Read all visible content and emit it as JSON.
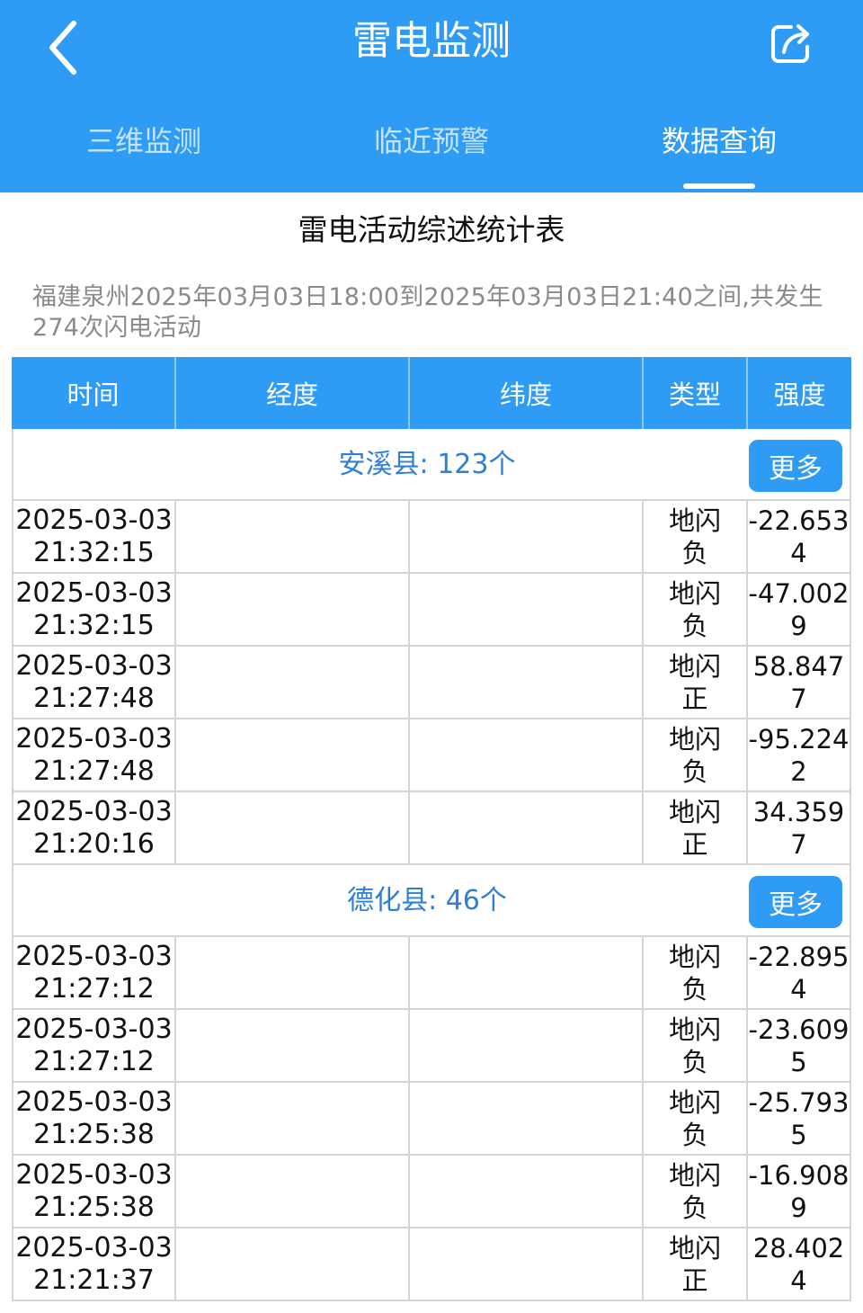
{
  "colors": {
    "accent": "#2e9cf4",
    "link": "#2e7fd6"
  },
  "header": {
    "title": "雷电监测",
    "back_icon": "chevron-left-icon",
    "share_icon": "share-icon"
  },
  "tabs": [
    {
      "label": "三维监测",
      "active": false
    },
    {
      "label": "临近预警",
      "active": false
    },
    {
      "label": "数据查询",
      "active": true
    }
  ],
  "report": {
    "title": "雷电活动综述统计表",
    "summary": "福建泉州2025年03月03日18:00到2025年03月03日21:40之间,共发生274次闪电活动"
  },
  "table": {
    "columns": [
      "时间",
      "经度",
      "纬度",
      "类型",
      "强度"
    ],
    "more_label": "更多",
    "groups": [
      {
        "label": "安溪县: 123个",
        "rows": [
          {
            "date": "2025-03-03",
            "time": "21:32:15",
            "lon": "",
            "lat": "",
            "type": "地闪负",
            "strength": "-22.6534"
          },
          {
            "date": "2025-03-03",
            "time": "21:32:15",
            "lon": "",
            "lat": "",
            "type": "地闪负",
            "strength": "-47.0029"
          },
          {
            "date": "2025-03-03",
            "time": "21:27:48",
            "lon": "",
            "lat": "",
            "type": "地闪正",
            "strength": "58.8477"
          },
          {
            "date": "2025-03-03",
            "time": "21:27:48",
            "lon": "",
            "lat": "",
            "type": "地闪负",
            "strength": "-95.2242"
          },
          {
            "date": "2025-03-03",
            "time": "21:20:16",
            "lon": "",
            "lat": "",
            "type": "地闪正",
            "strength": "34.3597"
          }
        ]
      },
      {
        "label": "德化县: 46个",
        "rows": [
          {
            "date": "2025-03-03",
            "time": "21:27:12",
            "lon": "",
            "lat": "",
            "type": "地闪负",
            "strength": "-22.8954"
          },
          {
            "date": "2025-03-03",
            "time": "21:27:12",
            "lon": "",
            "lat": "",
            "type": "地闪负",
            "strength": "-23.6095"
          },
          {
            "date": "2025-03-03",
            "time": "21:25:38",
            "lon": "",
            "lat": "",
            "type": "地闪负",
            "strength": "-25.7935"
          },
          {
            "date": "2025-03-03",
            "time": "21:25:38",
            "lon": "",
            "lat": "",
            "type": "地闪负",
            "strength": "-16.9089"
          },
          {
            "date": "2025-03-03",
            "time": "21:21:37",
            "lon": "",
            "lat": "",
            "type": "地闪正",
            "strength": "28.4024"
          }
        ]
      }
    ]
  }
}
